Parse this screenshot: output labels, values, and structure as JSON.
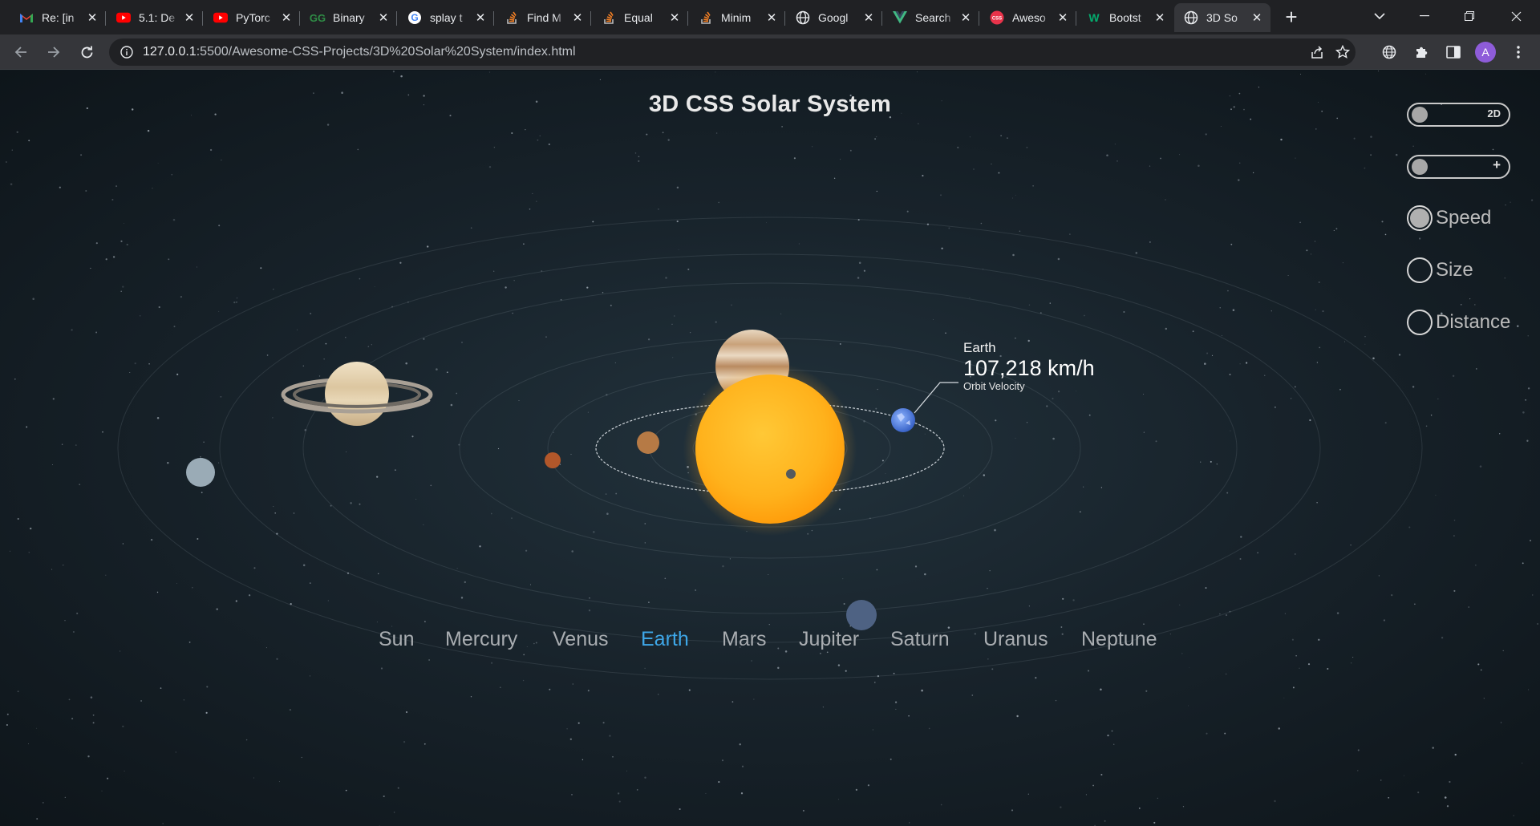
{
  "browser": {
    "tabs": [
      {
        "title": "Re: [in",
        "icon": "gmail-icon"
      },
      {
        "title": "5.1: De",
        "icon": "youtube-icon"
      },
      {
        "title": "PyTorc",
        "icon": "youtube-icon"
      },
      {
        "title": "Binary",
        "icon": "geeksforgeeks-icon"
      },
      {
        "title": "splay t",
        "icon": "google-icon"
      },
      {
        "title": "Find M",
        "icon": "stackoverflow-icon"
      },
      {
        "title": "Equal",
        "icon": "stackoverflow-icon"
      },
      {
        "title": "Minim",
        "icon": "stackoverflow-icon"
      },
      {
        "title": "Googl",
        "icon": "globe-icon"
      },
      {
        "title": "Search",
        "icon": "vue-icon"
      },
      {
        "title": "Aweso",
        "icon": "css-icon"
      },
      {
        "title": "Bootst",
        "icon": "w3schools-icon"
      },
      {
        "title": "3D So",
        "icon": "globe-icon",
        "active": true
      }
    ],
    "url_host": "127.0.0.1",
    "url_path": ":5500/Awesome-CSS-Projects/3D%20Solar%20System/index.html",
    "avatar_letter": "A"
  },
  "page": {
    "title": "3D CSS Solar System",
    "controls": {
      "toggle_view_label": "2D",
      "toggle_zoom_label": "+",
      "radio_options": [
        "Speed",
        "Size",
        "Distance"
      ],
      "selected_option": "Speed"
    },
    "info": {
      "planet": "Earth",
      "value": "107,218 km/h",
      "caption": "Orbit Velocity"
    },
    "nav": [
      "Sun",
      "Mercury",
      "Venus",
      "Earth",
      "Mars",
      "Jupiter",
      "Saturn",
      "Uranus",
      "Neptune"
    ],
    "active_planet": "Earth",
    "colors": {
      "accent": "#3ea7e8",
      "sun": "#ffb31f",
      "background": "#1b2730"
    }
  }
}
